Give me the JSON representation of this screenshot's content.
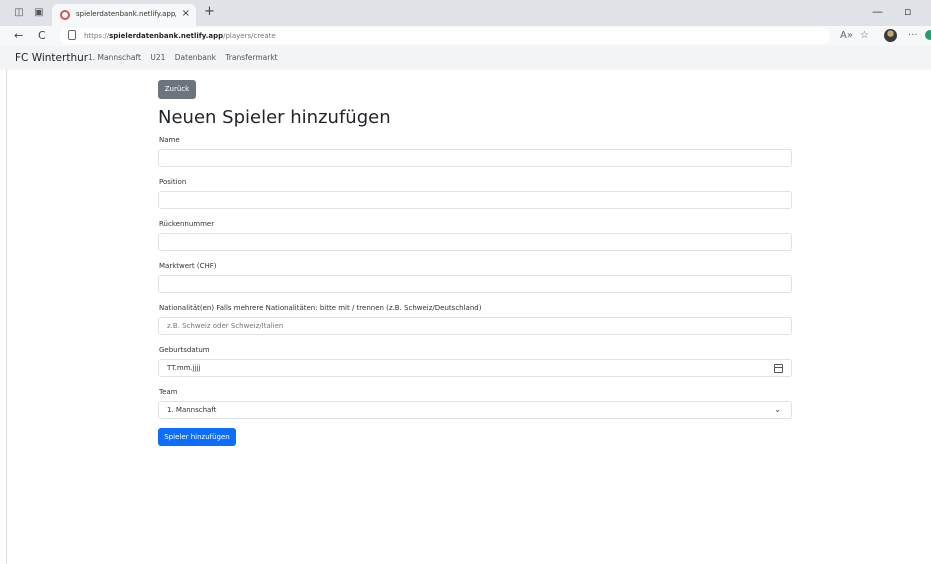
{
  "browser": {
    "tab_title": "spielerdatenbank.netlify.app/pla",
    "tab_close": "×",
    "new_tab": "+",
    "url_prefix": "https://",
    "url_host": "spielerdatenbank.netlify.app",
    "url_path": "/players/create",
    "minimize": "—",
    "restore": "▫",
    "more": "···"
  },
  "navbar": {
    "brand": "FC Winterthur",
    "links": [
      "1. Mannschaft",
      "U21",
      "Datenbank",
      "Transfermarkt"
    ]
  },
  "page": {
    "back_label": "Zurück",
    "title": "Neuen Spieler hinzufügen"
  },
  "form": {
    "name_label": "Name",
    "name_value": "",
    "position_label": "Position",
    "position_value": "",
    "number_label": "Rückennummer",
    "number_value": "",
    "value_label": "Marktwert (CHF)",
    "value_value": "",
    "nationality_label": "Nationalität(en) Falls mehrere Nationalitäten: bitte mit / trennen (z.B. Schweiz/Deutschland)",
    "nationality_placeholder": "z.B. Schweiz oder Schweiz/Italien",
    "birthdate_label": "Geburtsdatum",
    "birthdate_placeholder": "TT.mm.jjjj",
    "team_label": "Team",
    "team_selected": "1. Mannschaft",
    "submit_label": "Spieler hinzufügen"
  },
  "icons": {
    "back": "←",
    "reload": "C",
    "read_aloud": "A»",
    "favorite": "☆",
    "chevron": "⌄"
  }
}
